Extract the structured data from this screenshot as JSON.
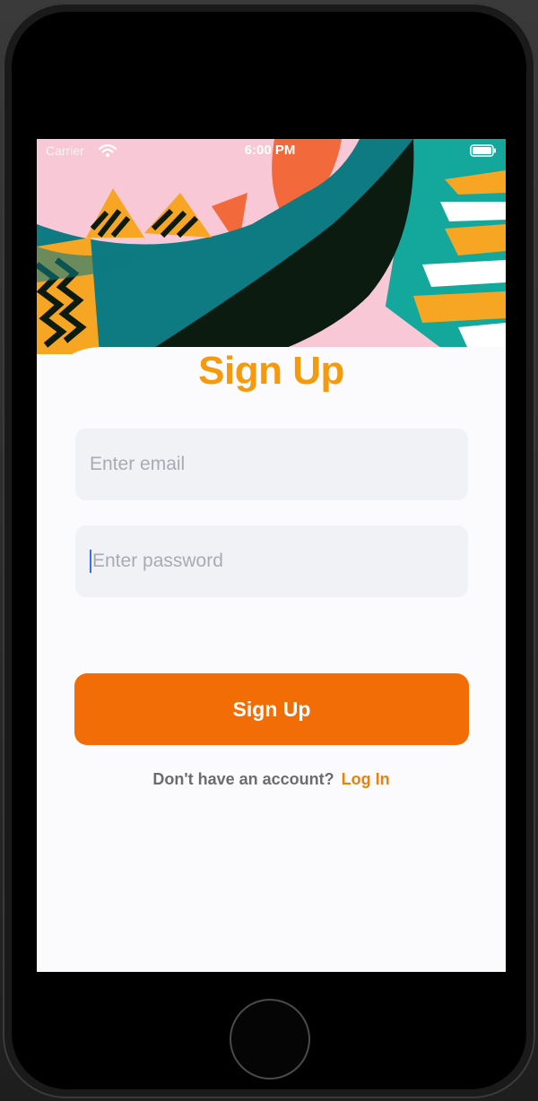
{
  "status_bar": {
    "carrier": "Carrier",
    "time": "6:00 PM",
    "wifi_icon": "wifi-icon",
    "battery_icon": "battery-icon"
  },
  "hero": {
    "image": "abstract-colorful-pattern"
  },
  "signup": {
    "title": "Sign Up",
    "email_placeholder": "Enter email",
    "password_placeholder": "Enter password",
    "button_label": "Sign Up",
    "footer_prompt": "Don't have an account?",
    "footer_link": "Log In"
  },
  "colors": {
    "accent_title": "#f59a0c",
    "button": "#f26d06",
    "link": "#e8820a",
    "input_bg": "#f0f2f6",
    "caret": "#3c6df0"
  }
}
